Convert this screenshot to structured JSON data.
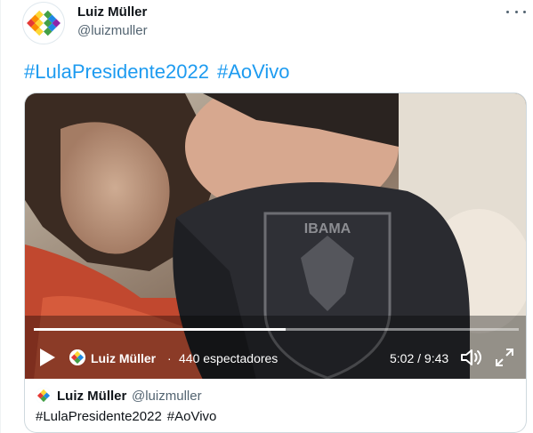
{
  "author": {
    "name": "Luiz Müller",
    "handle": "@luizmuller"
  },
  "tweet": {
    "hashtags": [
      "#LulaPresidente2022",
      "#AoVivo"
    ]
  },
  "video": {
    "channel_name": "Luiz Müller",
    "separator": "·",
    "viewers": "440 espectadores",
    "time": "5:02 / 9:43",
    "progress_fraction": 0.52,
    "patch_text": "IBAMA"
  },
  "quote": {
    "name": "Luiz Müller",
    "handle": "@luizmuller",
    "hashtags": [
      "#LulaPresidente2022",
      "#AoVivo"
    ]
  },
  "icons": {
    "more": "more-horizontal-icon",
    "play": "play-icon",
    "volume": "volume-icon",
    "fullscreen": "fullscreen-icon"
  },
  "colors": {
    "link": "#1d9bf0",
    "secondary_text": "#536471",
    "video_overlay_text": "#ffffff"
  }
}
